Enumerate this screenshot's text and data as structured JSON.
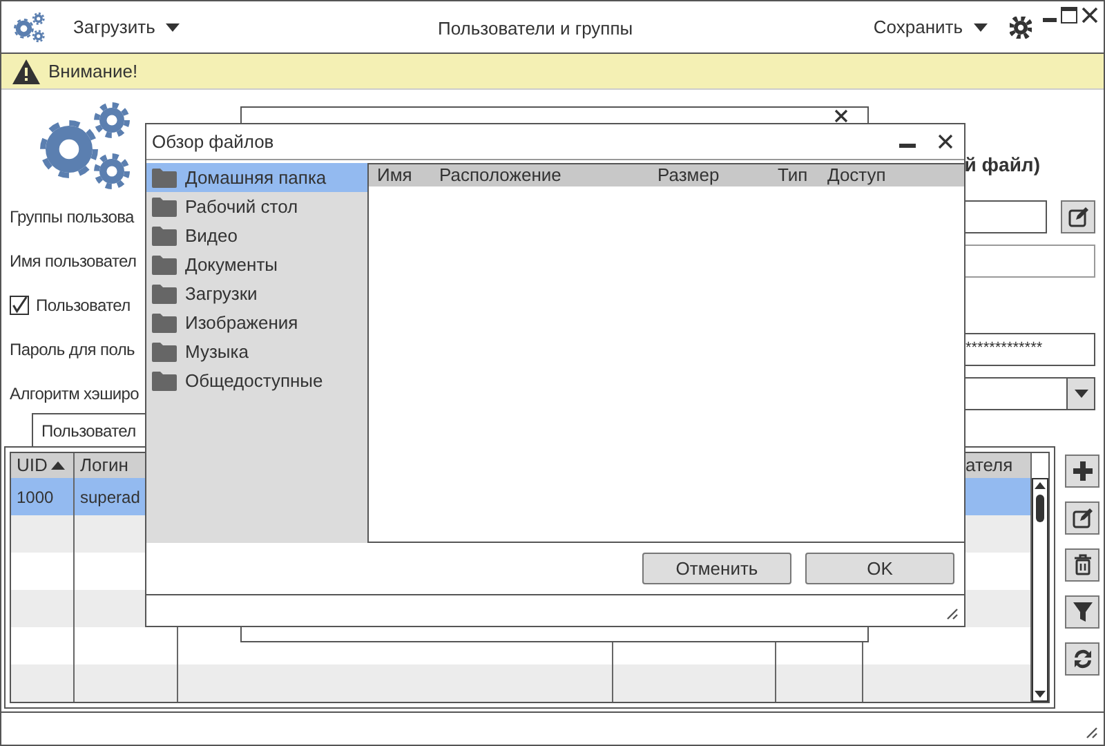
{
  "window": {
    "title": "Пользователи и группы"
  },
  "toolbar": {
    "load_menu": "Загрузить",
    "save_menu": "Сохранить"
  },
  "warning": {
    "text": "Внимание!"
  },
  "heading_fragment": "й файл)",
  "form": [
    {
      "kind": "field-edit",
      "label": "Группы пользова"
    },
    {
      "kind": "field",
      "label": "Имя пользовател"
    },
    {
      "kind": "checkbox",
      "label": "Пользовател",
      "checked": true
    },
    {
      "kind": "password",
      "label": "Пароль для поль",
      "value": "*************"
    },
    {
      "kind": "select",
      "label": "Алгоритм хэширо"
    }
  ],
  "tabs": [
    {
      "label": "Пользовател",
      "selected": true
    }
  ],
  "table": {
    "columns": [
      {
        "label": "UID",
        "sorted": true
      },
      {
        "label": "Логин",
        "sorted": false
      },
      {
        "label": "ателя",
        "sorted": false
      }
    ],
    "rows": [
      {
        "cells": [
          "1000",
          "superad"
        ],
        "selected": true
      }
    ]
  },
  "side_buttons": [
    {
      "kind": "add"
    },
    {
      "kind": "edit"
    },
    {
      "kind": "delete"
    },
    {
      "kind": "filter"
    },
    {
      "kind": "refresh"
    }
  ],
  "file_dialog": {
    "title": "Обзор файлов",
    "places": [
      {
        "label": "Домашняя папка",
        "selected": true
      },
      {
        "label": "Рабочий стол",
        "selected": false
      },
      {
        "label": "Видео",
        "selected": false
      },
      {
        "label": "Документы",
        "selected": false
      },
      {
        "label": "Загрузки",
        "selected": false
      },
      {
        "label": "Изображения",
        "selected": false
      },
      {
        "label": "Музыка",
        "selected": false
      },
      {
        "label": "Общедоступные",
        "selected": false
      }
    ],
    "columns": [
      "Имя",
      "Расположение",
      "Размер",
      "Тип",
      "Доступ"
    ],
    "buttons": [
      "Отменить",
      "OK"
    ]
  }
}
